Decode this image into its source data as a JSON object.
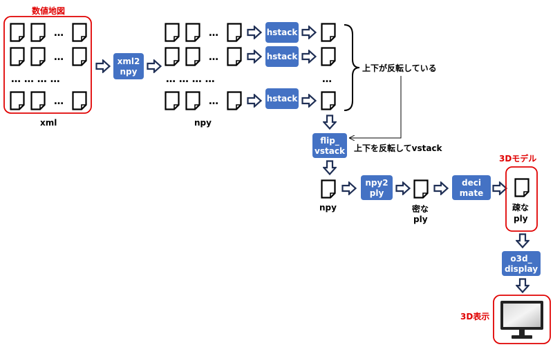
{
  "labels": {
    "map_title": "数値地図",
    "xml": "xml",
    "npy1": "npy",
    "flipped_note": "上下が反転している",
    "flip_note": "上下を反転してvstack",
    "npy2": "npy",
    "dense_1": "密な",
    "dense_2": "ply",
    "sparse_1": "疎な",
    "sparse_2": "ply",
    "model_title": "3Dモデル",
    "display_title": "3D表示",
    "ellipsis": "…",
    "ellipsis_row": "…  …  …  …"
  },
  "boxes": {
    "xml2npy_1": "xml2",
    "xml2npy_2": "npy",
    "hstack": "hstack",
    "flip_1": "flip_",
    "flip_2": "vstack",
    "npy2ply_1": "npy2",
    "npy2ply_2": "ply",
    "decimate_1": "deci",
    "decimate_2": "mate",
    "o3d_1": "o3d_",
    "o3d_2": "display"
  },
  "colors": {
    "box_fill": "#4472c4",
    "accent_red": "#e00000",
    "arrow_stroke": "#1f2f55"
  }
}
